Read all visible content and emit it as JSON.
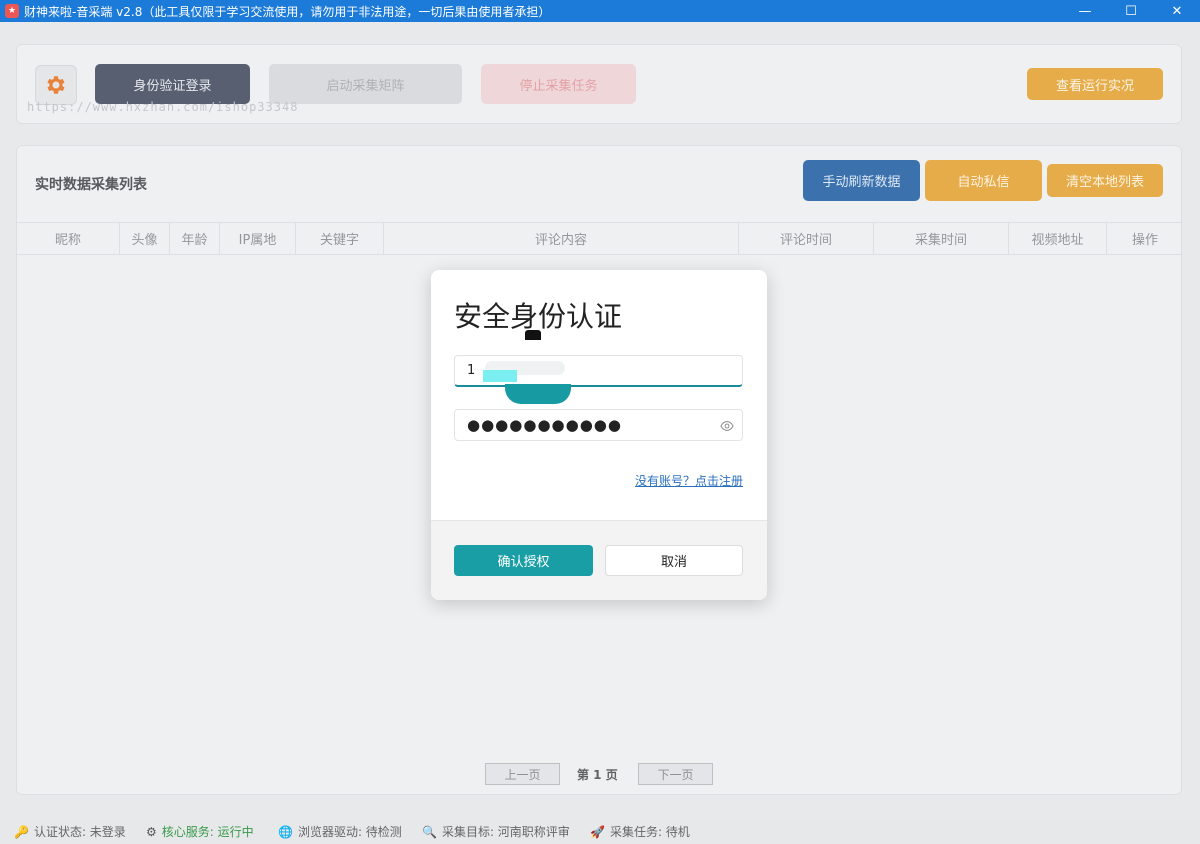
{
  "window": {
    "title": "财神来啦-音采端 v2.8（此工具仅限于学习交流使用，请勿用于非法用途，一切后果由使用者承担）",
    "minimize": "—",
    "maximize": "☐",
    "close": "✕"
  },
  "toolbar": {
    "login_label": "身份验证登录",
    "start_label": "启动采集矩阵",
    "stop_label": "停止采集任务",
    "view_label": "查看运行实况",
    "watermark": "https://www.hxzhan.com/ishop33348",
    "accent_color": "#e3a53a"
  },
  "list": {
    "title": "实时数据采集列表",
    "refresh_label": "手动刷新数据",
    "dm_label": "自动私信",
    "clear_label": "清空本地列表",
    "columns": [
      "昵称",
      "头像",
      "年龄",
      "IP属地",
      "关键字",
      "评论内容",
      "评论时间",
      "采集时间",
      "视频地址",
      "操作"
    ]
  },
  "pager": {
    "prev_label": "上一页",
    "current_label": "第 1 页",
    "next_label": "下一页"
  },
  "status": {
    "auth": "认证状态: 未登录",
    "core": "核心服务: 运行中",
    "browser": "浏览器驱动: 待检测",
    "target": "采集目标: 河南职称评审",
    "task": "采集任务: 待机"
  },
  "modal": {
    "title": "安全身份认证",
    "username_value": "1",
    "password_value": "●●●●●●●●●●●",
    "register_link": "没有账号？点击注册",
    "confirm_label": "确认授权",
    "cancel_label": "取消",
    "primary_color": "#1a9ea6"
  }
}
